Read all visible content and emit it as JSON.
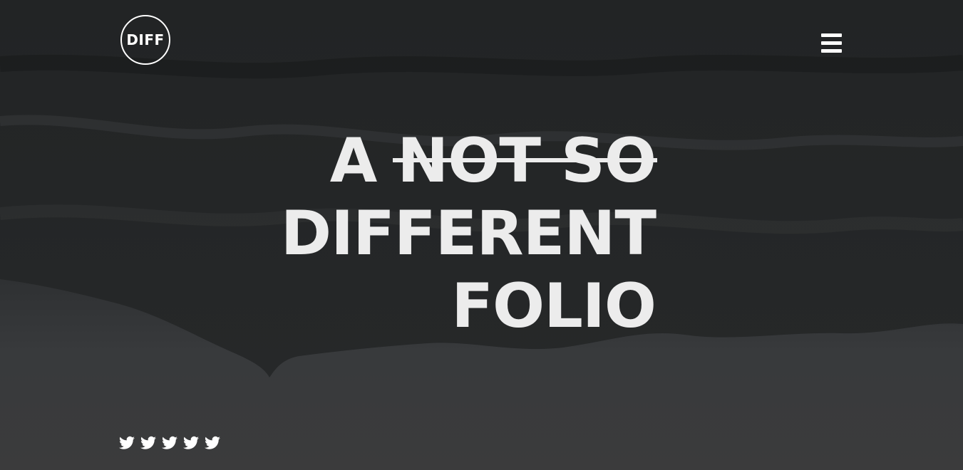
{
  "header": {
    "logo_text": "DIFF",
    "menu_icon": "hamburger-menu-icon"
  },
  "hero": {
    "line1_plain": "A",
    "line1_struck": "NOT SO",
    "line2": "DIFFERENT",
    "line3": "FOLIO"
  },
  "social": {
    "icons": [
      "twitter-icon",
      "twitter-icon",
      "twitter-icon",
      "twitter-icon",
      "twitter-icon"
    ]
  },
  "colors": {
    "text": "#ececec",
    "background": "#2b2c2e",
    "accent": "#ffffff"
  }
}
